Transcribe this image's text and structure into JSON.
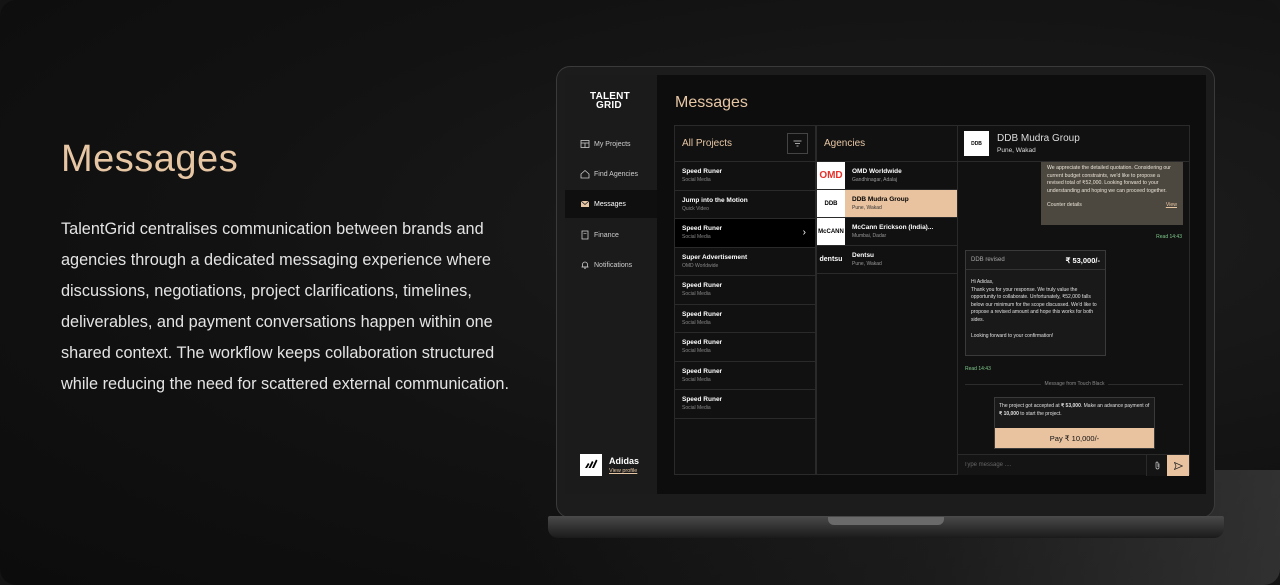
{
  "hero": {
    "title": "Messages",
    "text": "TalentGrid centralises communication between brands and agencies through a dedicated messaging experience where discussions, negotiations, project clarifications, timelines, deliverables, and payment conversations happen within one shared context. The workflow keeps collaboration structured while reducing the need for scattered external communication."
  },
  "app": {
    "logo_line1": "TALENT",
    "logo_line2": "GRID",
    "page_title": "Messages",
    "nav": [
      {
        "label": "My Projects",
        "icon": "projects-icon"
      },
      {
        "label": "Find Agencies",
        "icon": "home-icon"
      },
      {
        "label": "Messages",
        "icon": "mail-icon"
      },
      {
        "label": "Finance",
        "icon": "document-icon"
      },
      {
        "label": "Notifications",
        "icon": "bell-icon"
      }
    ],
    "profile": {
      "name": "Adidas",
      "link": "View profile"
    }
  },
  "projects": {
    "header": "All Projects",
    "items": [
      {
        "name": "Speed Runer",
        "category": "Social Media"
      },
      {
        "name": "Jump into the Motion",
        "category": "Quick Video"
      },
      {
        "name": "Speed Runer",
        "category": "Social Media"
      },
      {
        "name": "Super Advertisement",
        "category": "OMD Worldwide"
      },
      {
        "name": "Speed Runer",
        "category": "Social Media"
      },
      {
        "name": "Speed Runer",
        "category": "Social Media"
      },
      {
        "name": "Speed Runer",
        "category": "Social Media"
      },
      {
        "name": "Speed Runer",
        "category": "Social Media"
      },
      {
        "name": "Speed Runer",
        "category": "Social Media"
      }
    ]
  },
  "agencies": {
    "header": "Agencies",
    "items": [
      {
        "name": "OMD Worldwide",
        "location": "Gandhinagar, Adalaj",
        "logo": "OMD"
      },
      {
        "name": "DDB Mudra Group",
        "location": "Pune, Wakad",
        "logo": "DDB"
      },
      {
        "name": "McCann Erickson (India)...",
        "location": "Mumbai, Dadar",
        "logo": "McCANN"
      },
      {
        "name": "Dentsu",
        "location": "Pune, Wakad",
        "logo": "dentsu"
      }
    ]
  },
  "chat": {
    "name": "DDB Mudra Group",
    "location": "Pune, Wakad",
    "logo": "DDB",
    "bubble_text": "We appreciate the detailed quotation. Considering our current budget constraints, we'd like to propose a revised total of ₹52,000. Looking forward to your understanding and hoping we can proceed together.",
    "bubble_footer": "Counter details",
    "bubble_view": "View",
    "read1": "Read 14:43",
    "card_label": "DDB revised",
    "card_amount": "₹ 53,000/-",
    "card_greeting": "Hi Adidas,",
    "card_body": "Thank you for your response. We truly value the opportunity to collaborate. Unfortunately, ₹52,000 falls below our minimum for the scope discussed. We'd like to propose a revised amount and hope this works for both sides.",
    "card_closing": "Looking forward to your confirmation!",
    "read2": "Read 14:43",
    "divider_label": "Message from Touch Black",
    "pay_text_1": "The project got accepted at",
    "pay_amount_1": "₹ 53,000",
    "pay_text_2": ". Make an advance payment of",
    "pay_amount_2": "₹ 10,000",
    "pay_text_3": "to start the project.",
    "pay_button": "Pay ₹ 10,000/-",
    "compose_placeholder": "Type message ...."
  },
  "colors": {
    "accent": "#e7c6a4",
    "highlight": "#e9c3a0",
    "read": "#7ec98a"
  }
}
